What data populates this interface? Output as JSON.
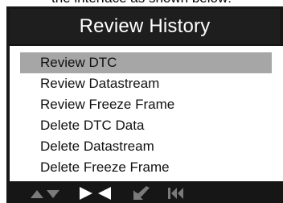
{
  "caption_fragment": "the interface as shown below:",
  "header": {
    "title": "Review History"
  },
  "menu": {
    "selected_index": 0,
    "items": [
      {
        "label": "Review DTC"
      },
      {
        "label": "Review Datastream"
      },
      {
        "label": "Review Freeze Frame"
      },
      {
        "label": "Delete DTC Data"
      },
      {
        "label": "Delete Datastream"
      },
      {
        "label": "Delete Freeze Frame"
      }
    ]
  },
  "footer": {
    "icons": [
      "up-down-arrows-icon",
      "right-left-arrows-icon",
      "enter-icon",
      "skip-back-icon"
    ],
    "colors": {
      "bright": "#ffffff",
      "dim": "#7a7a7a"
    }
  }
}
